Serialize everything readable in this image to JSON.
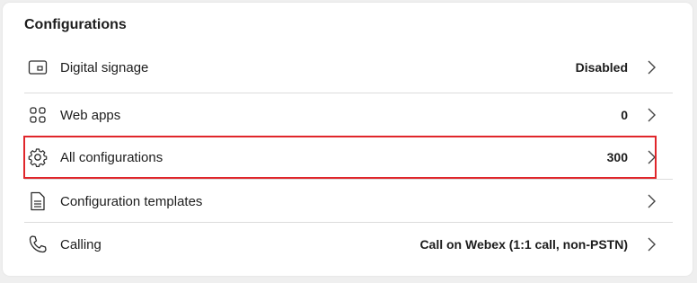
{
  "section": {
    "title": "Configurations"
  },
  "rows": [
    {
      "label": "Digital signage",
      "value": "Disabled",
      "icon": "display-icon"
    },
    {
      "label": "Web apps",
      "value": "0",
      "icon": "apps-grid-icon"
    },
    {
      "label": "All configurations",
      "value": "300",
      "icon": "gear-icon"
    },
    {
      "label": "Configuration templates",
      "value": "",
      "icon": "document-icon"
    },
    {
      "label": "Calling",
      "value": "Call on Webex (1:1 call, non-PSTN)",
      "icon": "phone-icon"
    }
  ],
  "highlight_color": "#e0262b"
}
